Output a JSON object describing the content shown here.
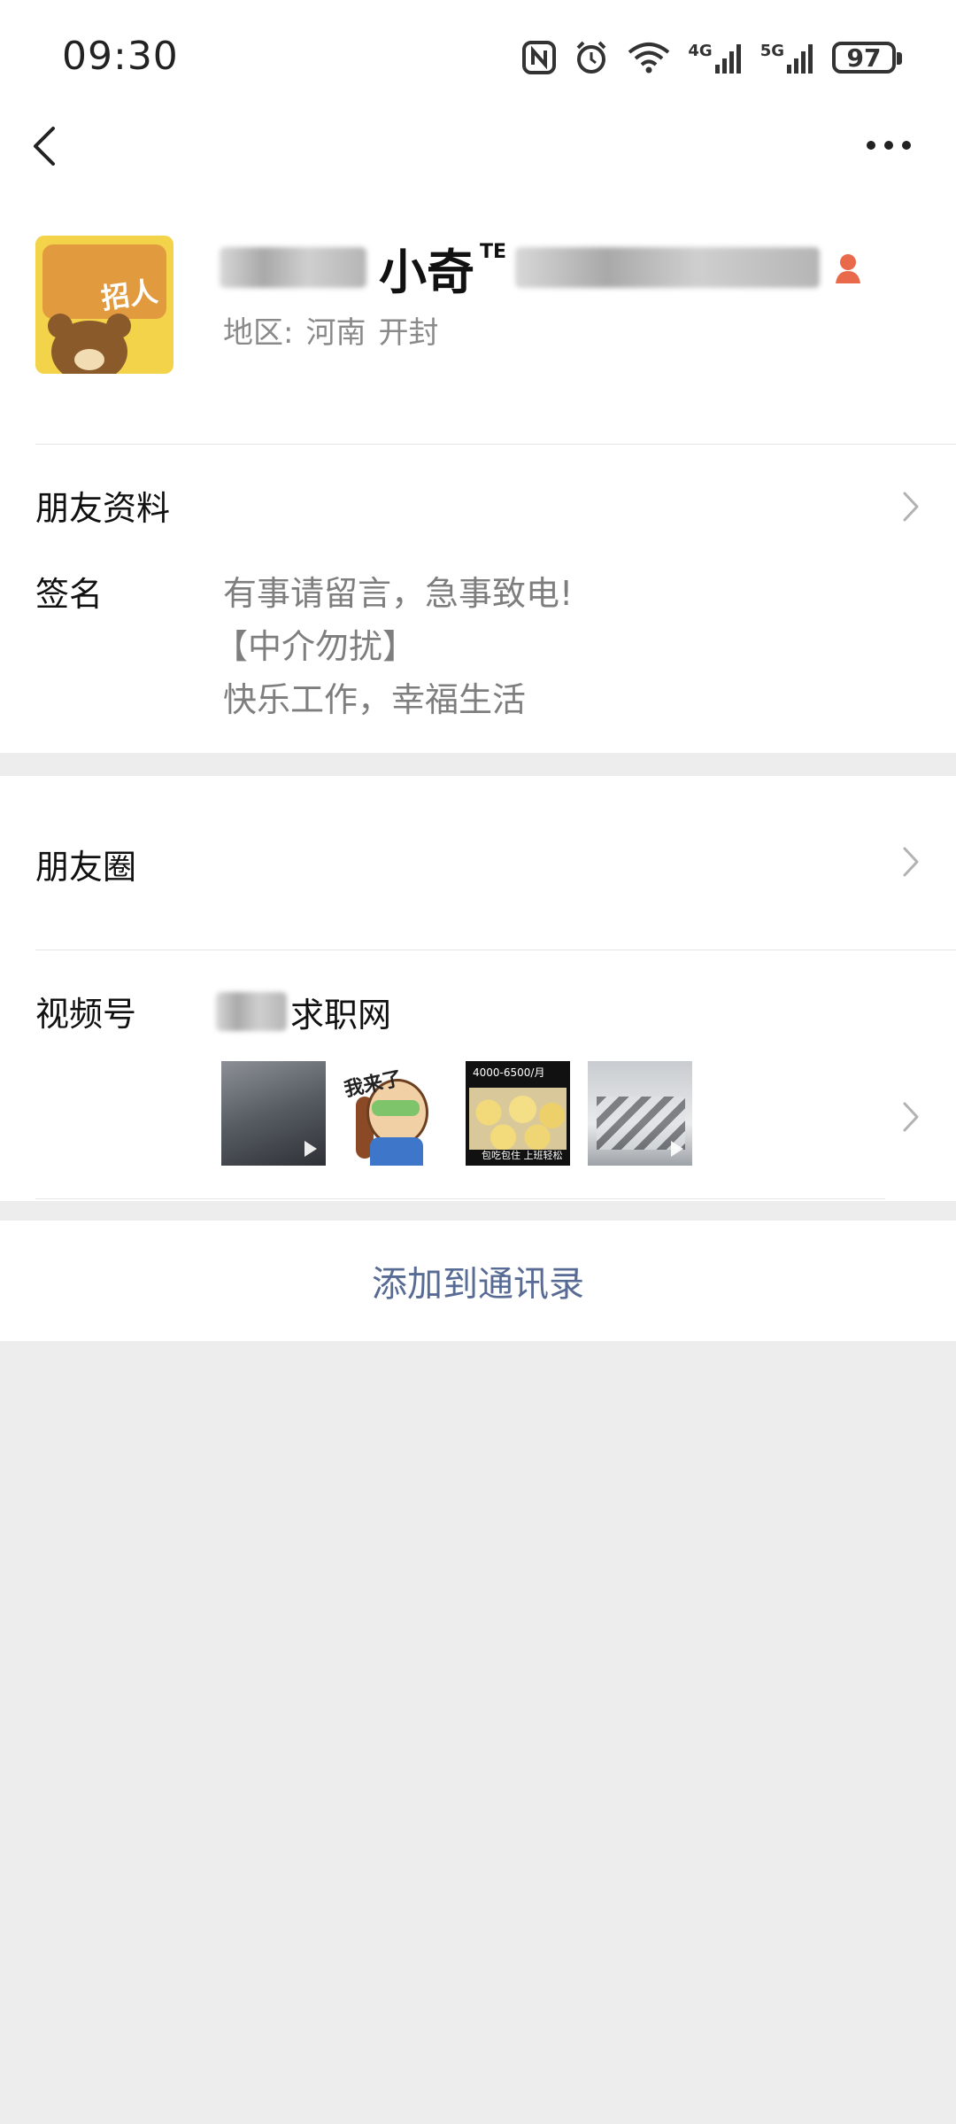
{
  "status_bar": {
    "time": "09:30",
    "network_labels": [
      "4G",
      "5G"
    ],
    "battery": "97"
  },
  "nav": {
    "back_icon": "chevron-left-icon",
    "more_icon": "more-horizontal-icon"
  },
  "profile": {
    "name": "小奇",
    "name_superscript": "TE",
    "region_label": "地区:",
    "region_values": [
      "河南",
      "开封"
    ],
    "gender_icon": "female-icon",
    "gender_color": "#fa5151"
  },
  "friend_info": {
    "label": "朋友资料"
  },
  "signature": {
    "label": "签名",
    "lines": [
      "有事请留言，急事致电!",
      "【中介勿扰】",
      "快乐工作，幸福生活"
    ]
  },
  "moments": {
    "label": "朋友圈"
  },
  "channels": {
    "label": "视频号",
    "name_suffix": "求职网",
    "thumbnail_captions": [
      "我来了",
      "4000-6500/月",
      "包吃包住 上班轻松"
    ]
  },
  "add_contact": {
    "label": "添加到通讯录",
    "color": "#576b95"
  }
}
